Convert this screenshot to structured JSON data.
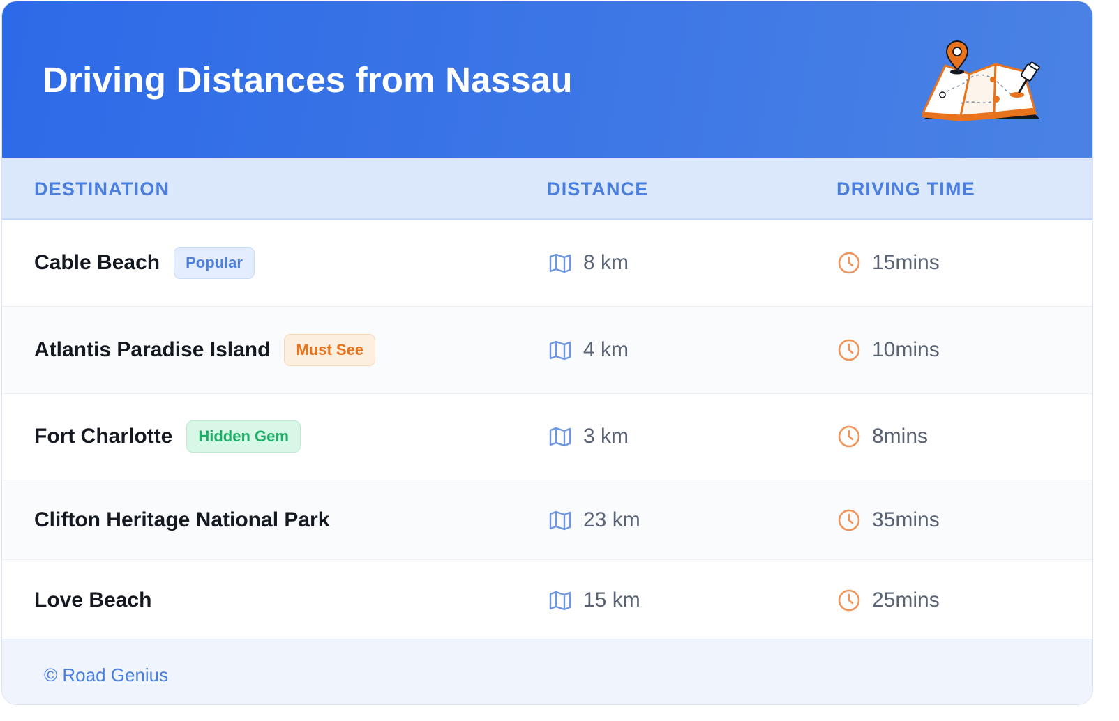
{
  "header": {
    "title": "Driving Distances from Nassau"
  },
  "columns": {
    "destination": "DESTINATION",
    "distance": "DISTANCE",
    "driving_time": "DRIVING TIME"
  },
  "rows": [
    {
      "destination": "Cable Beach",
      "badge": "Popular",
      "badge_color": "#4f80dc",
      "distance": "8 km",
      "time": "15mins"
    },
    {
      "destination": "Atlantis Paradise Island",
      "badge": "Must See",
      "badge_color": "#e8731c",
      "distance": "4 km",
      "time": "10mins"
    },
    {
      "destination": "Fort Charlotte",
      "badge": "Hidden Gem",
      "badge_color": "#1fae6a",
      "distance": "3 km",
      "time": "8mins"
    },
    {
      "destination": "Clifton Heritage National Park",
      "badge": "",
      "distance": "23 km",
      "time": "35mins"
    },
    {
      "destination": "Love Beach",
      "badge": "",
      "distance": "15 km",
      "time": "25mins"
    }
  ],
  "icons": {
    "distance": "map-icon",
    "time": "clock-icon",
    "header": "folded-map-with-pin-icon"
  },
  "colors": {
    "header_blue": "#2d6ae7",
    "accent_orange": "#e8731c",
    "accent_blue": "#4a7fe0"
  },
  "footer": {
    "text": "© Road Genius"
  }
}
